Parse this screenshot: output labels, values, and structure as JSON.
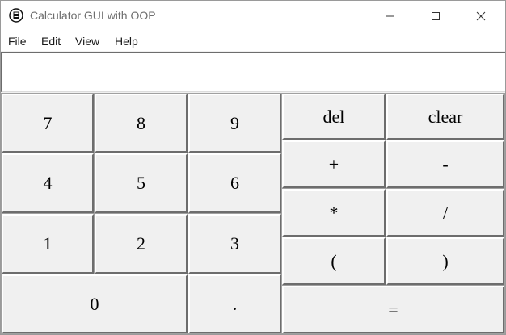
{
  "window": {
    "title": "Calculator GUI with OOP",
    "controls": {
      "minimize": "—",
      "maximize": "☐",
      "close": "✕"
    }
  },
  "menubar": {
    "items": [
      "File",
      "Edit",
      "View",
      "Help"
    ]
  },
  "display": {
    "value": ""
  },
  "keypad": {
    "numbers": [
      "7",
      "8",
      "9",
      "4",
      "5",
      "6",
      "1",
      "2",
      "3",
      "0",
      "."
    ],
    "operators": [
      "del",
      "clear",
      "+",
      "-",
      "*",
      "/",
      "(",
      ")",
      "="
    ]
  },
  "colors": {
    "button_face": "#f0f0f0",
    "title_text": "#6e6e6e"
  }
}
